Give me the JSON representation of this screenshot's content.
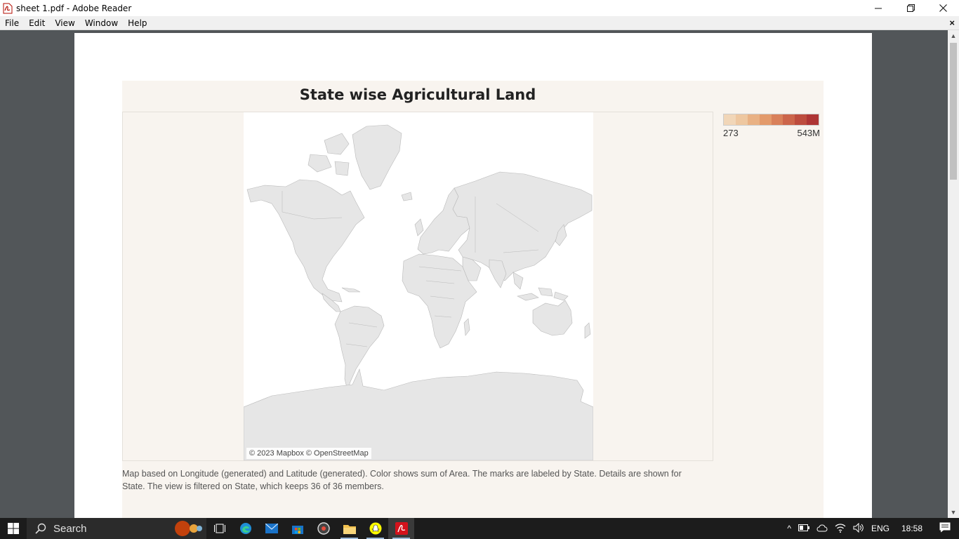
{
  "window": {
    "title": "sheet 1.pdf - Adobe Reader",
    "minimize": "—",
    "maximize": "❐",
    "close": "✕"
  },
  "menu": {
    "items": [
      "File",
      "Edit",
      "View",
      "Window",
      "Help"
    ],
    "close": "×"
  },
  "document": {
    "title": "State wise Agricultural Land",
    "attribution": "© 2023 Mapbox © OpenStreetMap",
    "legend": {
      "min_label": "273",
      "max_label": "543M",
      "colors": [
        "#f1d6b8",
        "#eec7a0",
        "#e9b184",
        "#e39a6b",
        "#d9805a",
        "#cc654b",
        "#bd4c3e",
        "#ae3535"
      ]
    },
    "caption_line1": "Map based on Longitude (generated) and Latitude (generated).  Color shows sum of Area.  The marks are labeled by State.  Details are shown for",
    "caption_line2": "State. The view is filtered on State, which keeps 36 of 36 members."
  },
  "taskbar": {
    "search_label": "Search",
    "language": "ENG",
    "time": "18:58"
  },
  "colors": {
    "viewer_bg": "#525659",
    "dashboard_bg": "#f8f4ef",
    "land": "#e6e6e6",
    "borders": "#b9b9b9"
  }
}
